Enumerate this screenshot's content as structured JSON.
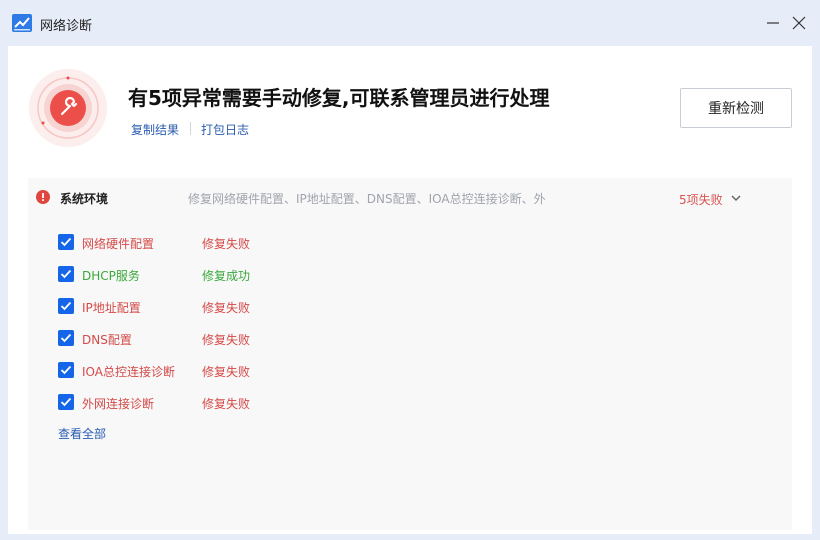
{
  "window": {
    "title": "网络诊断",
    "icon": "chart-line-icon"
  },
  "summary": {
    "headline": "有5项异常需要手动修复,可联系管理员进行处理",
    "copy_results": "复制结果",
    "pack_logs": "打包日志",
    "recheck": "重新检测",
    "illustration_icon": "wrench-icon"
  },
  "section": {
    "icon": "error-circle-icon",
    "title": "系统环境",
    "description": "修复网络硬件配置、IP地址配置、DNS配置、IOA总控连接诊断、外",
    "fail_count": "5项失败",
    "items": [
      {
        "label": "网络硬件配置",
        "status": "修复失败",
        "checked": true
      },
      {
        "label": "DHCP服务",
        "status": "修复成功",
        "checked": true
      },
      {
        "label": "IP地址配置",
        "status": "修复失败",
        "checked": true
      },
      {
        "label": "DNS配置",
        "status": "修复失败",
        "checked": true
      },
      {
        "label": "IOA总控连接诊断",
        "status": "修复失败",
        "checked": true
      },
      {
        "label": "外网连接诊断",
        "status": "修复失败",
        "checked": true
      }
    ],
    "view_all": "查看全部"
  },
  "colors": {
    "fail": "#d44a47",
    "success": "#3aa83a",
    "accent": "#1565e8",
    "link": "#2a5db0"
  }
}
